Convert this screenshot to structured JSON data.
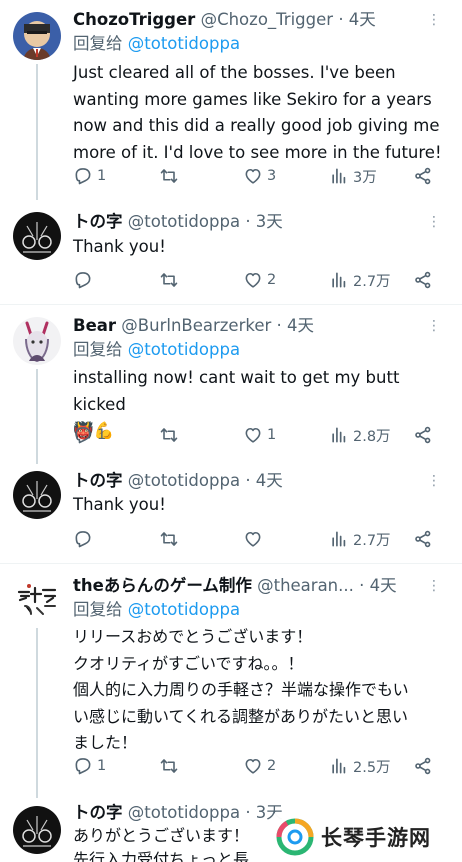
{
  "tweets": [
    {
      "name": "ChozoTrigger",
      "handle": "@Chozo_Trigger",
      "time": "· 4天",
      "reply_prefix": "回复给",
      "reply_to": "@tototidoppa",
      "text": "Just cleared all of the bosses. I've been\nwanting more games like Sekiro for a years\nnow and this did a really good job giving me\nmore of it. I'd love to see more in the future!",
      "replies": "1",
      "retweets": "",
      "likes": "3",
      "views": "3万"
    },
    {
      "name": "トの字",
      "handle": "@tototidoppa",
      "time": "· 3天",
      "text": "Thank you!",
      "replies": "",
      "retweets": "",
      "likes": "2",
      "views": "2.7万"
    },
    {
      "name": "Bear",
      "handle": "@BurlnBearzerker",
      "time": "· 4天",
      "reply_prefix": "回复给",
      "reply_to": "@tototidoppa",
      "text": "installing now! cant wait to get my butt kicked\n👹💪",
      "replies": "1",
      "retweets": "",
      "likes": "1",
      "views": "2.8万"
    },
    {
      "name": "トの字",
      "handle": "@tototidoppa",
      "time": "· 4天",
      "text": "Thank you!",
      "replies": "",
      "retweets": "",
      "likes": "",
      "views": "2.7万"
    },
    {
      "name": "theあらんのゲーム制作",
      "handle": "@thearan...",
      "time": "· 4天",
      "reply_prefix": "回复给",
      "reply_to": "@tototidoppa",
      "text": "リリースおめでとうございます！\nクオリティがすごいですね。。！\n個人的に入力周りの手軽さ？半端な操作でもい\nい感じに動いてくれる調整がありがたいと思い\nました！",
      "replies": "1",
      "retweets": "",
      "likes": "2",
      "views": "2.5万"
    },
    {
      "name": "トの字",
      "handle": "@tototidoppa",
      "time": "· 3天",
      "text": "ありがとうございます！\n先行入力受付ちょっと長"
    }
  ],
  "watermark": {
    "text": "长琴手游网"
  },
  "icons": {
    "reply": "reply-icon",
    "retweet": "retweet-icon",
    "like": "heart-icon",
    "views": "views-icon",
    "share": "share-icon",
    "more": "more-icon"
  },
  "colors": {
    "link": "#1d9bf0",
    "secondary": "#536471",
    "text": "#0f1419",
    "separator": "#eff3f4"
  }
}
